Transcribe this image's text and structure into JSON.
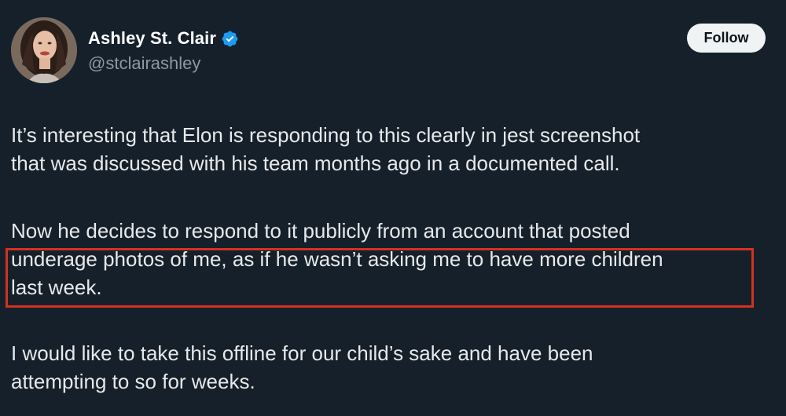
{
  "author": {
    "display_name": "Ashley St. Clair",
    "handle": "@stclairashley",
    "verified": true,
    "avatar_icon": "profile-photo"
  },
  "follow_button": {
    "label": "Follow"
  },
  "tweet": {
    "paragraphs": [
      {
        "lines": [
          "It’s interesting that Elon is responding to this clearly in jest screenshot",
          "that was discussed with his team months ago in a documented call."
        ]
      },
      {
        "lines": [
          "Now he decides to respond to it publicly from an account that posted",
          "underage photos of me, as if he wasn’t asking me to have more children",
          "last week."
        ]
      },
      {
        "lines": [
          "I would like to take this offline for our child’s sake and have been",
          "attempting to so for weeks."
        ]
      }
    ]
  },
  "colors": {
    "background": "#15202b",
    "text": "#e7e9ea",
    "secondary_text": "#8b98a5",
    "verified_badge": "#1d9bf0",
    "highlight_box": "#d3321f"
  }
}
